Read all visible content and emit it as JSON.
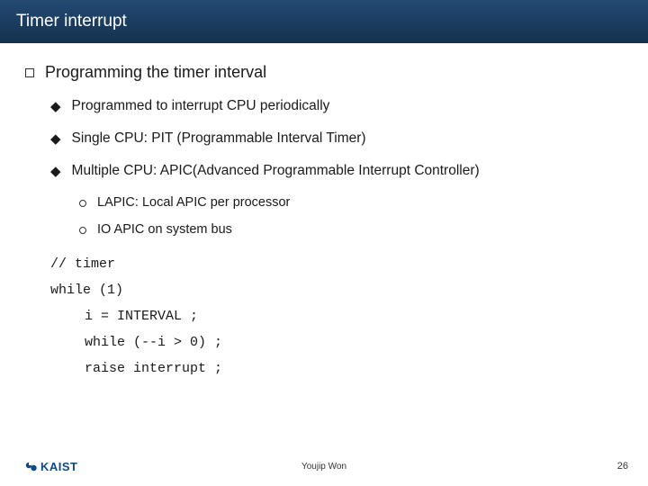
{
  "header": {
    "title": "Timer interrupt"
  },
  "section": {
    "heading": "Programming the timer interval",
    "bullets": [
      "Programmed to interrupt CPU periodically",
      "Single CPU: PIT (Programmable Interval Timer)",
      "Multiple CPU: APIC(Advanced Programmable Interrupt Controller)"
    ],
    "subbullets": [
      "LAPIC: Local APIC per processor",
      "IO APIC on system bus"
    ]
  },
  "code": {
    "comment": "// timer",
    "loop": "while (1)",
    "lines": [
      "i = INTERVAL ;",
      "while (--i > 0) ;",
      "raise interrupt ;"
    ]
  },
  "footer": {
    "logo_text": "KAIST",
    "author": "Youjip Won",
    "page": "26"
  }
}
